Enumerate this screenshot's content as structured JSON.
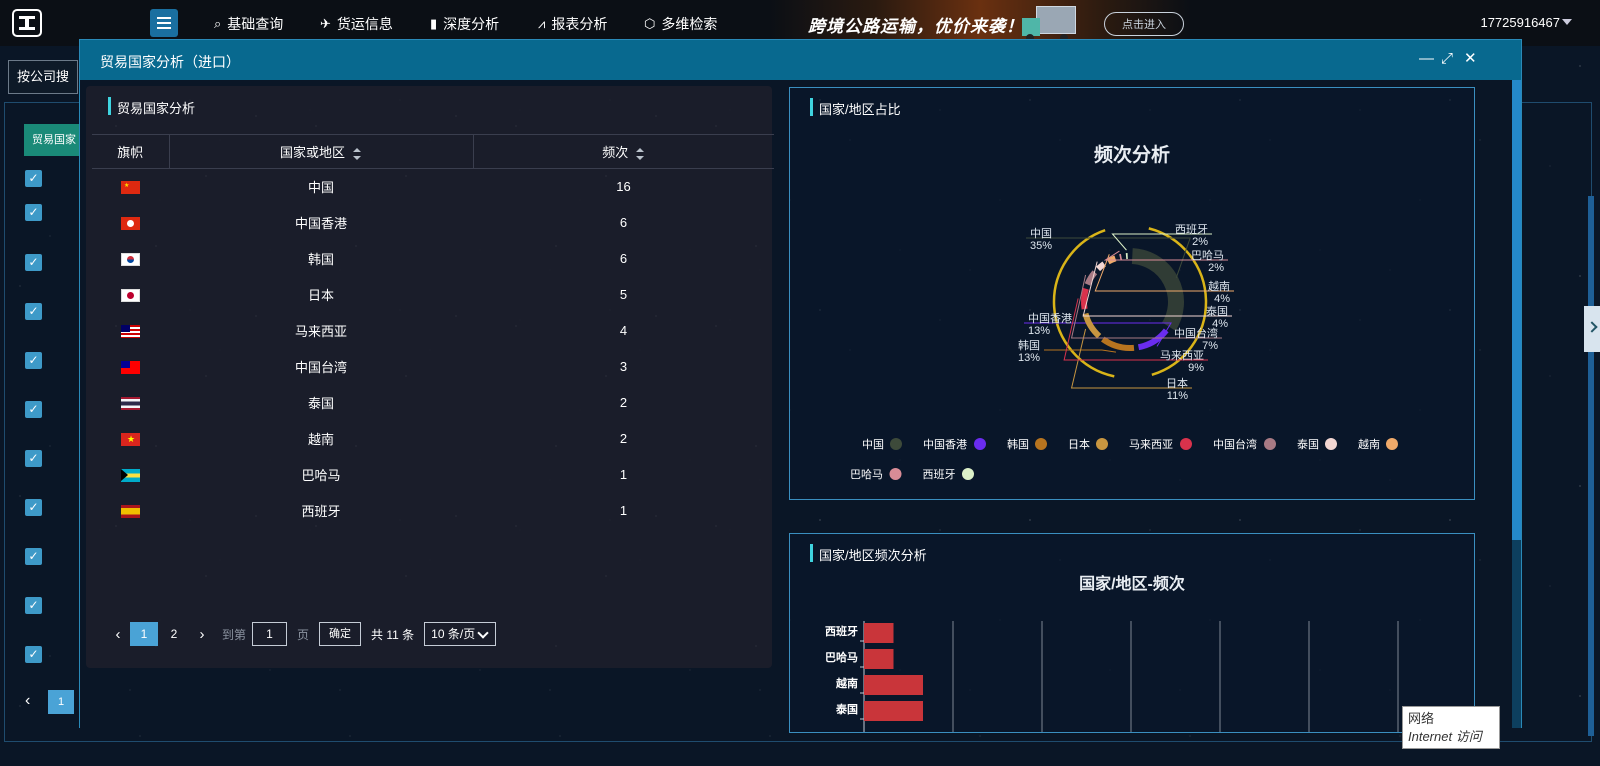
{
  "nav": {
    "items": [
      {
        "icon": "search-person-icon",
        "label": "基础查询"
      },
      {
        "icon": "plane-icon",
        "label": "货运信息"
      },
      {
        "icon": "bar-icon",
        "label": "深度分析"
      },
      {
        "icon": "line-chart-icon",
        "label": "报表分析"
      },
      {
        "icon": "cube-icon",
        "label": "多维检索"
      }
    ],
    "banner_text": "跨境公路运输，优价来袭！",
    "banner_button": "点击进入",
    "user": "17725916467"
  },
  "background": {
    "search_label": "按公司搜",
    "tab_label": "贸易国家",
    "pager_current": "1",
    "check_mark": "✓"
  },
  "modal": {
    "title": "贸易国家分析（进口）",
    "controls": {
      "minimize": "—",
      "maximize": "⤢",
      "close": "✕"
    },
    "left_panel": {
      "title": "贸易国家分析",
      "columns": [
        "旗帜",
        "国家或地区",
        "频次"
      ],
      "rows": [
        {
          "flag": "cn",
          "country": "中国",
          "count": "16"
        },
        {
          "flag": "hk",
          "country": "中国香港",
          "count": "6"
        },
        {
          "flag": "kr",
          "country": "韩国",
          "count": "6"
        },
        {
          "flag": "jp",
          "country": "日本",
          "count": "5"
        },
        {
          "flag": "my",
          "country": "马来西亚",
          "count": "4"
        },
        {
          "flag": "tw",
          "country": "中国台湾",
          "count": "3"
        },
        {
          "flag": "th",
          "country": "泰国",
          "count": "2"
        },
        {
          "flag": "vn",
          "country": "越南",
          "count": "2"
        },
        {
          "flag": "bs",
          "country": "巴哈马",
          "count": "1"
        },
        {
          "flag": "es",
          "country": "西班牙",
          "count": "1"
        }
      ],
      "pager": {
        "prev": "‹",
        "next": "›",
        "pages": [
          "1",
          "2"
        ],
        "current": "1",
        "goto_label": "到第",
        "goto_value": "1",
        "page_label": "页",
        "ok_label": "确定",
        "total": "共 11 条",
        "page_size": "10 条/页"
      }
    },
    "right_top": {
      "title": "国家/地区占比"
    },
    "right_bottom": {
      "title": "国家/地区频次分析"
    }
  },
  "tooltip": {
    "line1": "网络",
    "line2": "Internet 访问"
  },
  "chart_data": [
    {
      "type": "pie",
      "title": "频次分析",
      "labels": [
        "中国",
        "中国香港",
        "韩国",
        "日本",
        "马来西亚",
        "中国台湾",
        "泰国",
        "越南",
        "巴哈马",
        "西班牙"
      ],
      "values": [
        16,
        6,
        6,
        5,
        4,
        3,
        2,
        2,
        1,
        1
      ],
      "percent_labels": [
        "35%",
        "13%",
        "13%",
        "11%",
        "9%",
        "7%",
        "4%",
        "4%",
        "2%",
        "2%"
      ],
      "colors": [
        "#3d4a3a",
        "#6a2cf0",
        "#b7741f",
        "#c89640",
        "#d9324c",
        "#a87a84",
        "#f2d6d2",
        "#f0aa6a",
        "#d88c96",
        "#dcf0c8"
      ],
      "legend_placement": "bottom"
    },
    {
      "type": "bar",
      "orientation": "horizontal",
      "title": "国家/地区-频次",
      "categories": [
        "西班牙",
        "巴哈马",
        "越南",
        "泰国"
      ],
      "values": [
        1,
        1,
        2,
        2
      ],
      "bar_color": "#c9353a",
      "grid": true
    }
  ]
}
